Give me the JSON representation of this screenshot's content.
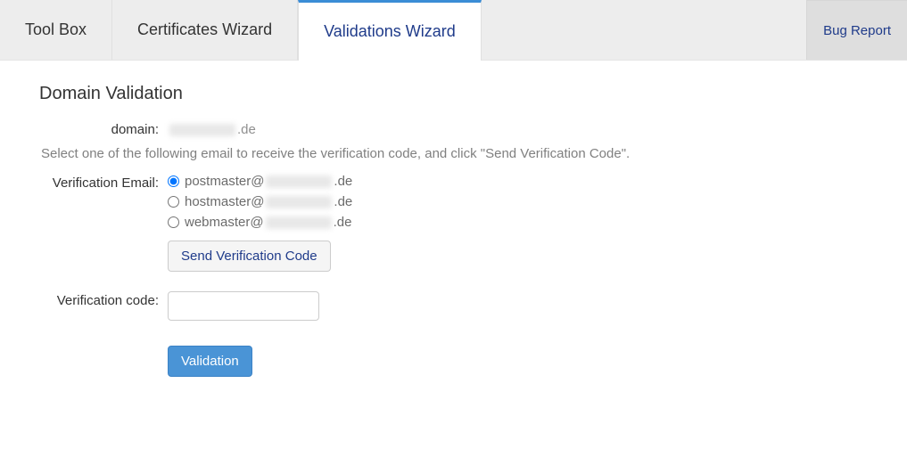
{
  "tabs": {
    "toolbox": "Tool Box",
    "certificates": "Certificates Wizard",
    "validations": "Validations Wizard",
    "bugreport": "Bug Report"
  },
  "page": {
    "title": "Domain Validation",
    "domain_label": "domain:",
    "domain_value_suffix": ".de",
    "instructions": "Select one of the following email to receive the verification code, and click \"Send Verification Code\".",
    "verif_email_label": "Verification Email:",
    "emails": [
      {
        "prefix": "postmaster@",
        "suffix": ".de",
        "checked": true
      },
      {
        "prefix": "hostmaster@",
        "suffix": ".de",
        "checked": false
      },
      {
        "prefix": "webmaster@",
        "suffix": ".de",
        "checked": false
      }
    ],
    "send_code_btn": "Send Verification Code",
    "verif_code_label": "Verification code:",
    "verif_code_value": "",
    "validation_btn": "Validation"
  }
}
